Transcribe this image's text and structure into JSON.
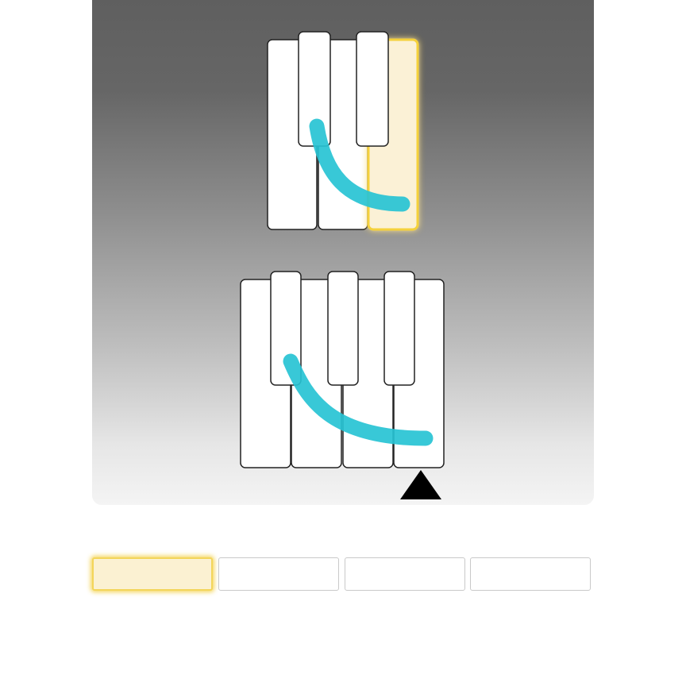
{
  "puzzle": {
    "top_keyboard": {
      "white_keys": 3,
      "highlighted_white_key_index": 2,
      "highlight_color": "#f5d13a",
      "highlight_fill": "#fbf1d6"
    },
    "bottom_keyboard": {
      "white_keys": 4,
      "marker_under_white_key_index": 3,
      "marker_icon": "triangle-up-icon"
    },
    "stroke_color": "#27c3d4"
  },
  "answers": {
    "slots": [
      {
        "label": "",
        "selected": true
      },
      {
        "label": "",
        "selected": false
      },
      {
        "label": "",
        "selected": false
      },
      {
        "label": "",
        "selected": false
      }
    ],
    "selected_color": "#f5d13a"
  }
}
